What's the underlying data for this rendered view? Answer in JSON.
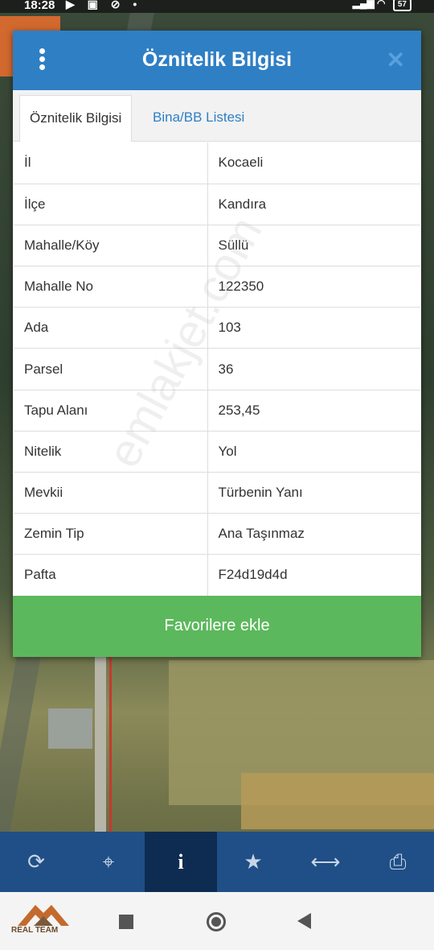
{
  "status_bar": {
    "time": "18:28",
    "battery": "57"
  },
  "dialog": {
    "title": "Öznitelik Bilgisi",
    "tabs": [
      {
        "label": "Öznitelik Bilgisi",
        "active": true
      },
      {
        "label": "Bina/BB Listesi",
        "active": false
      }
    ],
    "rows": [
      {
        "key": "İl",
        "value": "Kocaeli"
      },
      {
        "key": "İlçe",
        "value": "Kandıra"
      },
      {
        "key": "Mahalle/Köy",
        "value": "Süllü"
      },
      {
        "key": "Mahalle No",
        "value": "122350"
      },
      {
        "key": "Ada",
        "value": "103"
      },
      {
        "key": "Parsel",
        "value": "36"
      },
      {
        "key": "Tapu Alanı",
        "value": "253,45"
      },
      {
        "key": "Nitelik",
        "value": "Yol"
      },
      {
        "key": "Mevkii",
        "value": "Türbenin Yanı"
      },
      {
        "key": "Zemin Tip",
        "value": "Ana Taşınmaz"
      },
      {
        "key": "Pafta",
        "value": "F24d19d4d"
      }
    ],
    "favorite_button": "Favorilere ekle"
  },
  "watermark": "emlakjet.com",
  "toolbar": {
    "icons": [
      "refresh-icon",
      "locate-icon",
      "info-icon",
      "star-icon",
      "measure-icon",
      "print-icon"
    ],
    "active": "info-icon"
  },
  "logo": {
    "text": "REAL TEAM"
  },
  "colors": {
    "header": "#2f7fc4",
    "favorite": "#5cb85c",
    "toolbar": "#1f4f86"
  }
}
